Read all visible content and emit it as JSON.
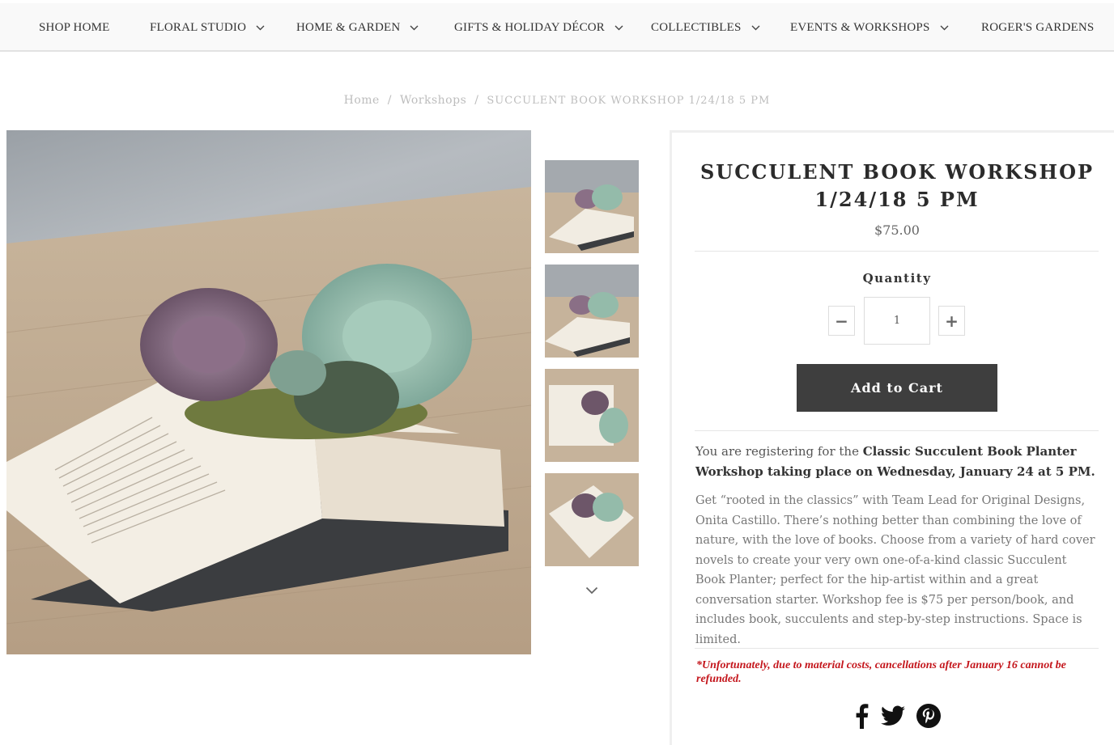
{
  "nav": {
    "items": [
      {
        "label": "SHOP HOME",
        "dropdown": false
      },
      {
        "label": "FLORAL STUDIO",
        "dropdown": true
      },
      {
        "label": "HOME & GARDEN",
        "dropdown": true
      },
      {
        "label": "GIFTS & HOLIDAY DÉCOR",
        "dropdown": true
      },
      {
        "label": "COLLECTIBLES",
        "dropdown": true
      },
      {
        "label": "EVENTS & WORKSHOPS",
        "dropdown": true
      },
      {
        "label": "ROGER'S GARDENS",
        "dropdown": false
      }
    ]
  },
  "breadcrumb": {
    "home": "Home",
    "separator": "/",
    "section": "Workshops",
    "current": "SUCCULENT BOOK WORKSHOP 1/24/18 5 PM"
  },
  "product": {
    "title_line1": "SUCCULENT BOOK WORKSHOP",
    "title_line2": "1/24/18 5 PM",
    "price": "$75.00",
    "quantity_label": "Quantity",
    "quantity_value": "1",
    "minus": "−",
    "plus": "+",
    "add_to_cart": "Add to Cart",
    "intro_prefix": "You are registering for the ",
    "intro_bold": "Classic Succulent Book Planter Workshop taking place on Wednesday, January 24 at 5 PM.",
    "description": "Get “rooted in the classics” with Team Lead for Original Designs, Onita Castillo.  There’s nothing better than combining the love of nature, with the love of books. Choose from a variety of hard cover novels to create your very own one-of-a-kind classic Succulent Book Planter; perfect for the hip-artist within and a great conversation starter.  Workshop fee is $75 per person/book, and includes book, succulents and step-by-step instructions. Space is limited.",
    "cancellation_note": "*Unfortunately, due to material costs, cancellations after January 16 cannot be refunded."
  },
  "gallery": {
    "thumbnail_count": 4,
    "next_icon": "chevron-down-icon"
  },
  "social": [
    "facebook-icon",
    "twitter-icon",
    "pinterest-icon"
  ],
  "colors": {
    "button_bg": "#3e3e3e",
    "note_red": "#c4161c",
    "nav_bg": "#f9f9f9"
  }
}
